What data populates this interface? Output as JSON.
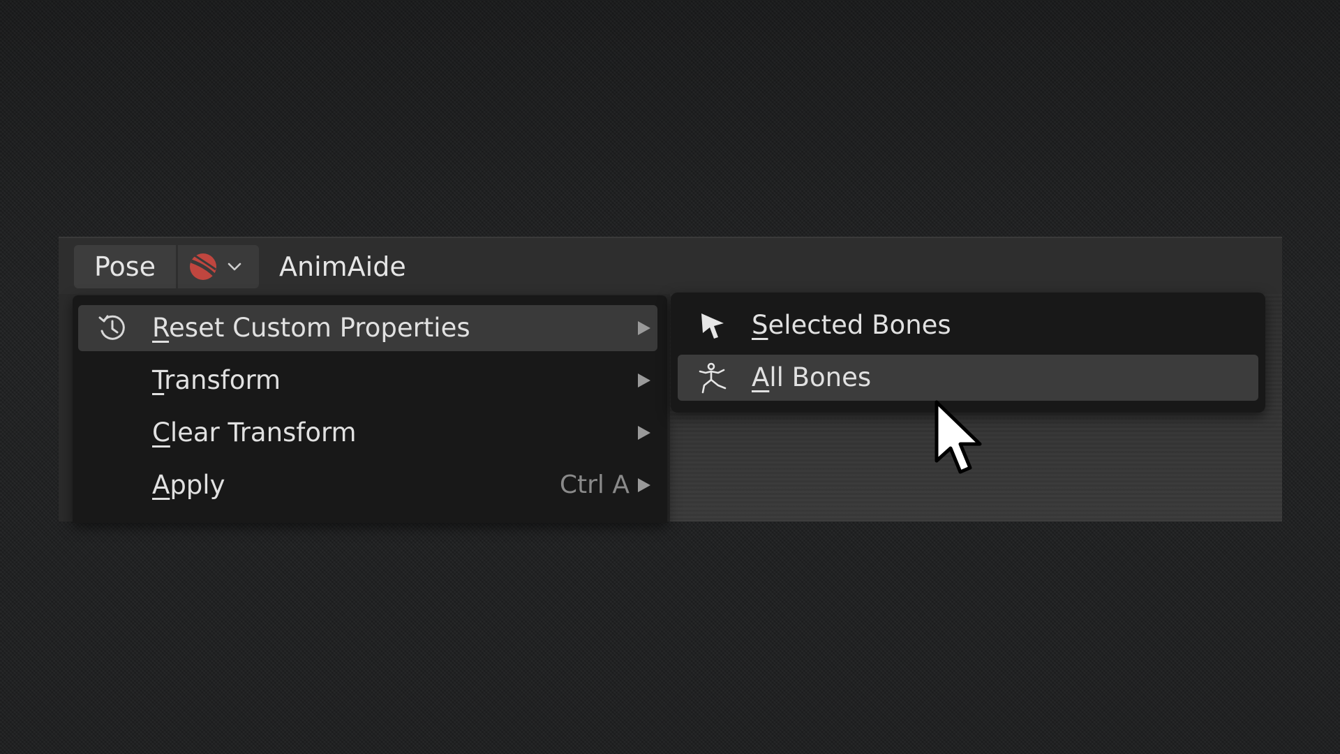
{
  "header": {
    "mode_label": "Pose",
    "addon_icon": "red-sphere-icon",
    "addon_dropdown_icon": "chevron-down-icon",
    "animaide_label": "AnimAide"
  },
  "menu": {
    "items": [
      {
        "ul": "R",
        "rest": "eset Custom Properties",
        "icon": "reset-history-icon",
        "shortcut": "",
        "has_submenu": true,
        "active": true
      },
      {
        "ul": "T",
        "rest": "ransform",
        "icon": "",
        "shortcut": "",
        "has_submenu": true,
        "active": false
      },
      {
        "ul": "C",
        "rest": "lear Transform",
        "icon": "",
        "shortcut": "",
        "has_submenu": true,
        "active": false
      },
      {
        "ul": "A",
        "rest": "pply",
        "icon": "",
        "shortcut": "Ctrl A",
        "has_submenu": true,
        "active": false
      }
    ]
  },
  "submenu": {
    "items": [
      {
        "ul": "S",
        "rest": "elected Bones",
        "icon": "cursor-arrow-icon",
        "active": false
      },
      {
        "ul": "A",
        "rest": "ll Bones",
        "icon": "armature-figure-icon",
        "active": true
      }
    ]
  },
  "colors": {
    "menu_bg": "#181818",
    "highlight": "#3a3a3a",
    "text": "#e1e1e1",
    "addon_accent": "#c0463f"
  }
}
